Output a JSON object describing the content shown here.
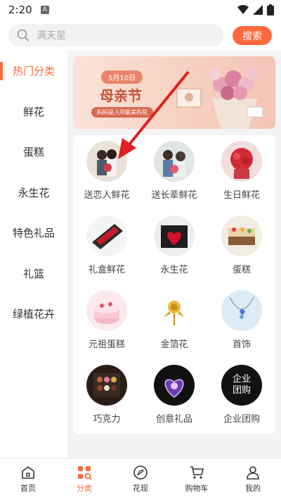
{
  "status": {
    "time": "2:20",
    "a_badge": "A"
  },
  "search": {
    "placeholder": "满天星",
    "button": "搜索"
  },
  "sidebar": {
    "items": [
      {
        "label": "热门分类",
        "active": true
      },
      {
        "label": "鲜花"
      },
      {
        "label": "蛋糕"
      },
      {
        "label": "永生花"
      },
      {
        "label": "特色礼品"
      },
      {
        "label": "礼篮"
      },
      {
        "label": "绿植花卉"
      }
    ]
  },
  "banner": {
    "date": "5月10日",
    "title": "母亲节",
    "subtitle": "妈妈是人间最美的花"
  },
  "categories": [
    {
      "label": "送恋人鲜花",
      "icon": "couple-flowers-icon"
    },
    {
      "label": "送长辈鲜花",
      "icon": "elder-flowers-icon"
    },
    {
      "label": "生日鲜花",
      "icon": "birthday-flowers-icon"
    },
    {
      "label": "礼盒鲜花",
      "icon": "gift-box-flowers-icon"
    },
    {
      "label": "永生花",
      "icon": "preserved-flower-icon"
    },
    {
      "label": "蛋糕",
      "icon": "cake-icon"
    },
    {
      "label": "元祖蛋糕",
      "icon": "pink-cake-icon"
    },
    {
      "label": "金箔花",
      "icon": "gold-rose-icon"
    },
    {
      "label": "首饰",
      "icon": "necklace-icon"
    },
    {
      "label": "巧克力",
      "icon": "chocolate-icon"
    },
    {
      "label": "创意礼品",
      "icon": "heart-crystal-icon"
    },
    {
      "label": "企业团购",
      "icon": "enterprise-icon",
      "badge_text": "企业团购"
    }
  ],
  "bottom_nav": [
    {
      "label": "首页"
    },
    {
      "label": "分类",
      "active": true
    },
    {
      "label": "花现"
    },
    {
      "label": "购物车"
    },
    {
      "label": "我的"
    }
  ],
  "colors": {
    "accent": "#ff6a3d"
  }
}
